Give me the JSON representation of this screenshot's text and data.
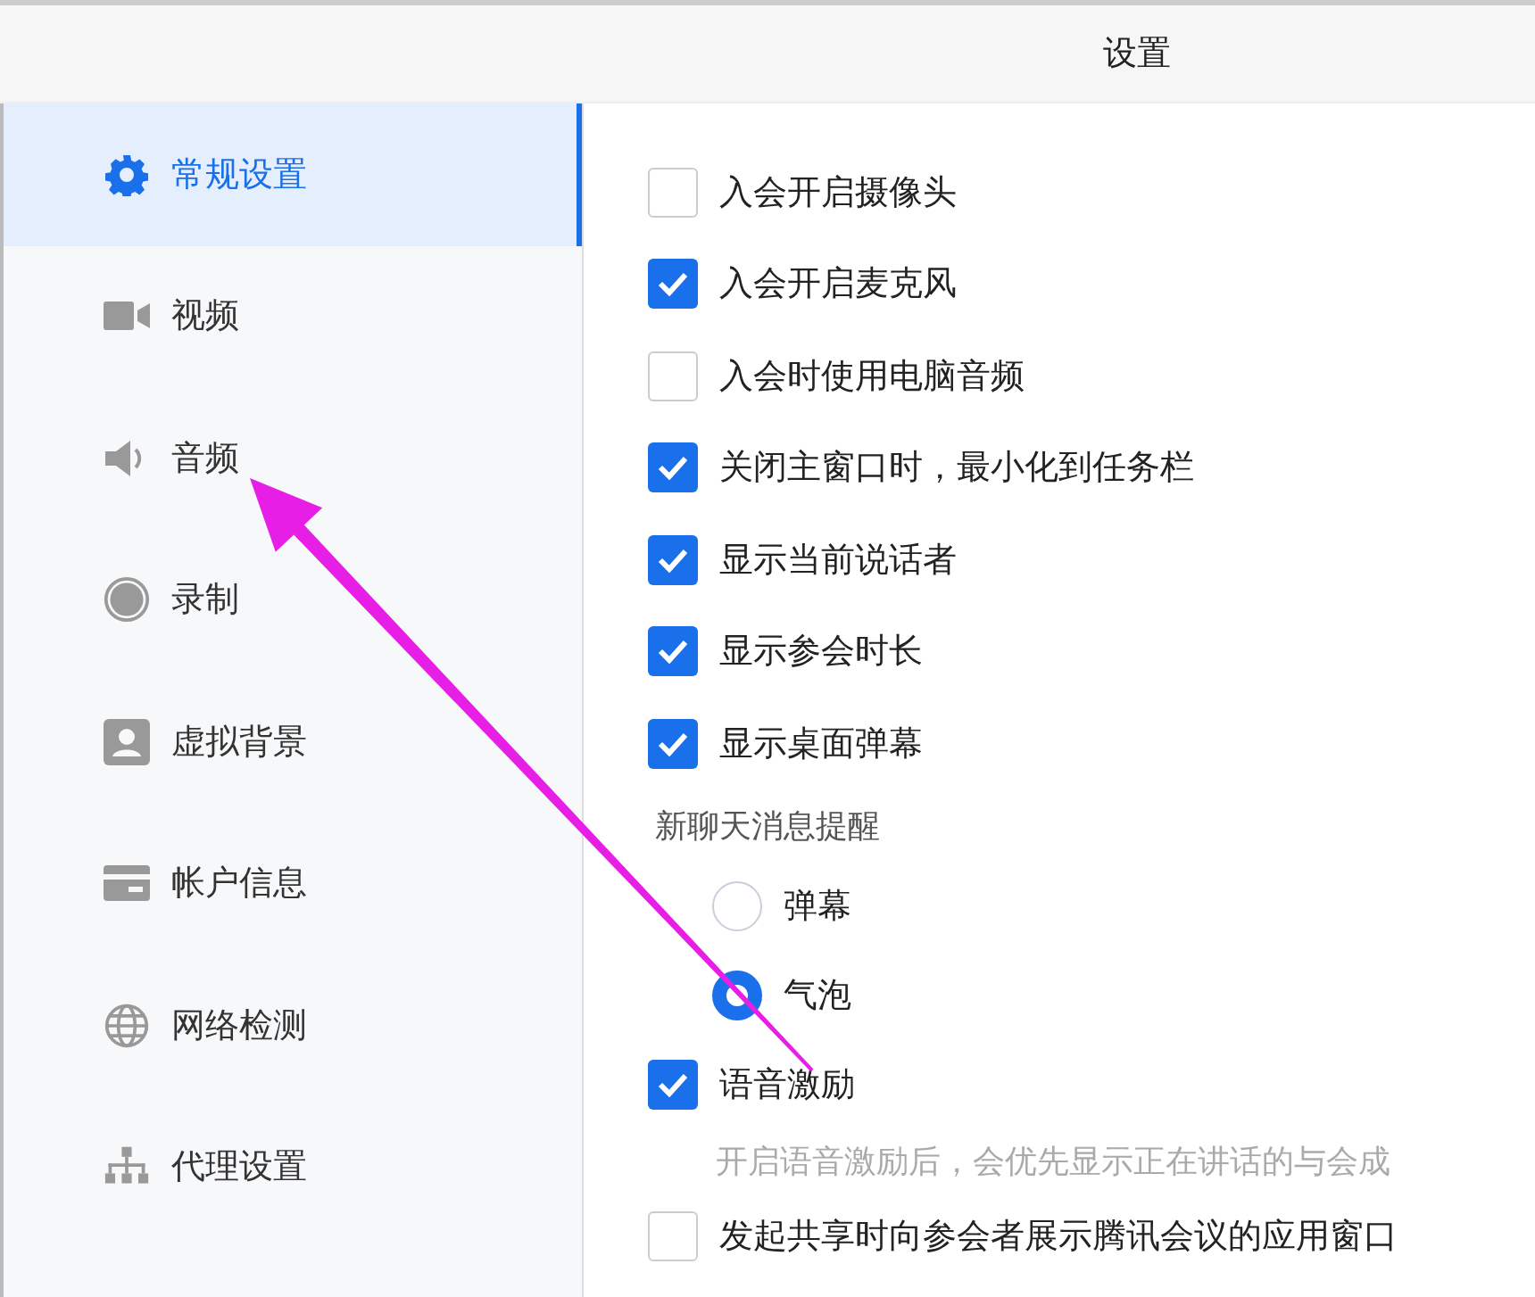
{
  "window": {
    "title": "设置"
  },
  "sidebar": {
    "items": [
      {
        "label": "常规设置",
        "selected": true
      },
      {
        "label": "视频",
        "selected": false
      },
      {
        "label": "音频",
        "selected": false
      },
      {
        "label": "录制",
        "selected": false
      },
      {
        "label": "虚拟背景",
        "selected": false
      },
      {
        "label": "帐户信息",
        "selected": false
      },
      {
        "label": "网络检测",
        "selected": false
      },
      {
        "label": "代理设置",
        "selected": false
      }
    ]
  },
  "settings": [
    {
      "kind": "checkbox",
      "label": "入会开启摄像头",
      "checked": false
    },
    {
      "kind": "checkbox",
      "label": "入会开启麦克风",
      "checked": true
    },
    {
      "kind": "checkbox",
      "label": "入会时使用电脑音频",
      "checked": false
    },
    {
      "kind": "checkbox",
      "label": "关闭主窗口时，最小化到任务栏",
      "checked": true
    },
    {
      "kind": "checkbox",
      "label": "显示当前说话者",
      "checked": true
    },
    {
      "kind": "checkbox",
      "label": "显示参会时长",
      "checked": true
    },
    {
      "kind": "checkbox",
      "label": "显示桌面弹幕",
      "checked": true
    },
    {
      "kind": "heading",
      "label": "新聊天消息提醒"
    },
    {
      "kind": "radio",
      "label": "弹幕",
      "selected": false
    },
    {
      "kind": "radio",
      "label": "气泡",
      "selected": true
    },
    {
      "kind": "checkbox",
      "label": "语音激励",
      "checked": true
    },
    {
      "kind": "hint",
      "label": "开启语音激励后，会优先显示正在讲话的与会成"
    },
    {
      "kind": "checkbox",
      "label": "发起共享时向参会者展示腾讯会议的应用窗口",
      "checked": false
    }
  ]
}
